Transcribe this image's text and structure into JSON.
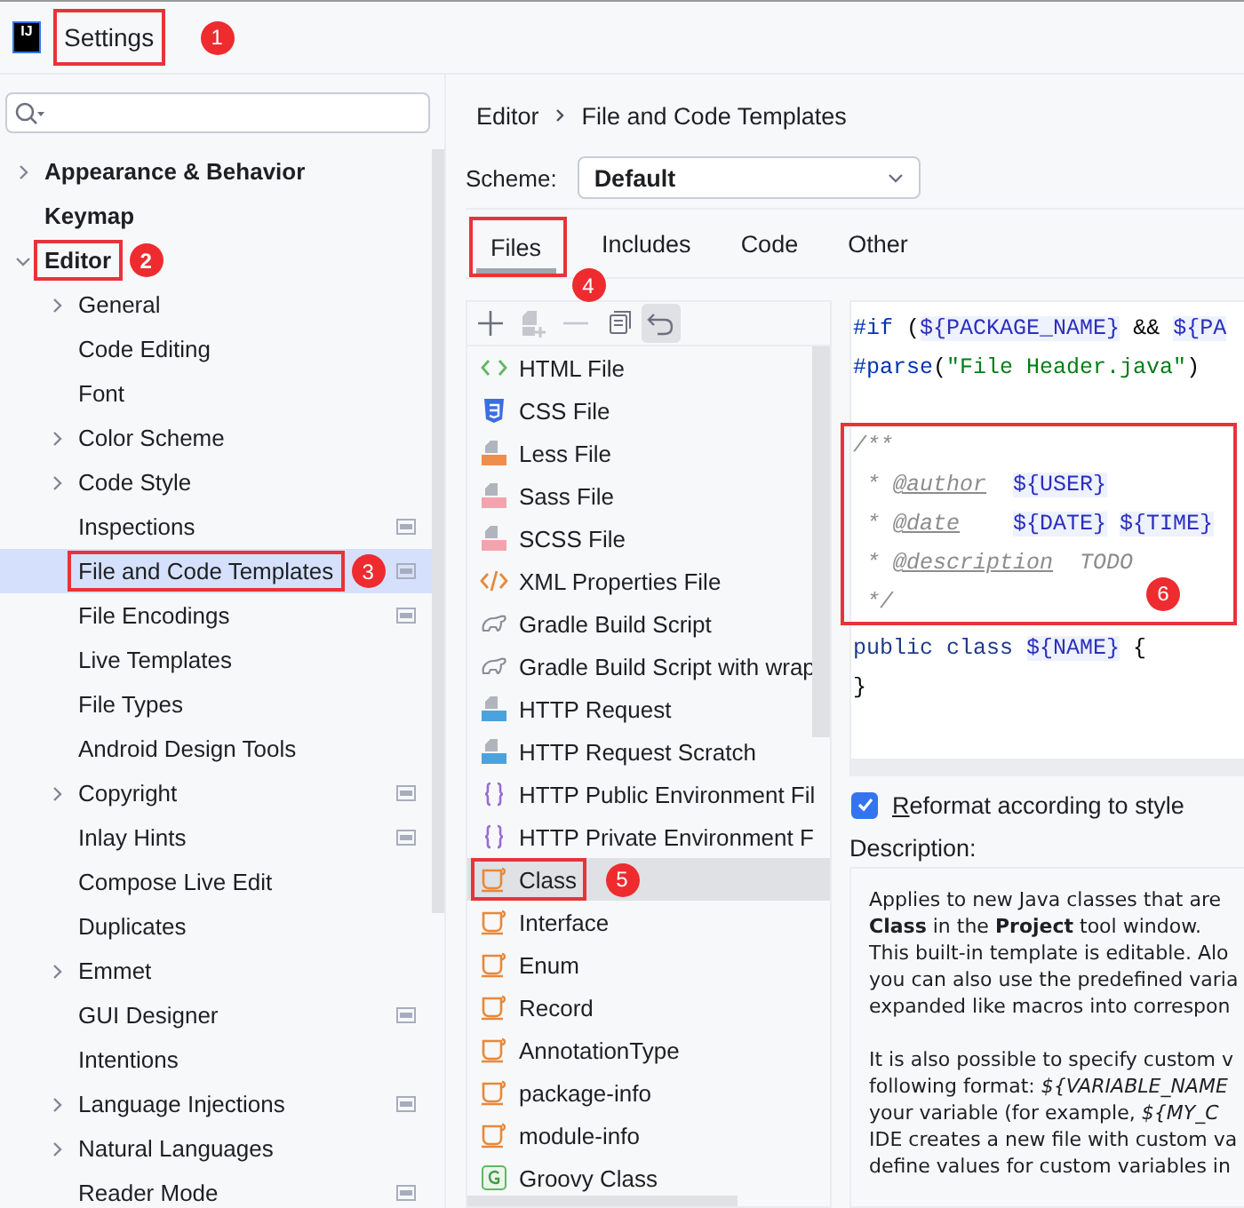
{
  "window": {
    "logo": "IJ",
    "title": "Settings",
    "callout": "1"
  },
  "sidebar": {
    "tree": [
      {
        "label": "Appearance & Behavior",
        "expandable": true,
        "expanded": false,
        "project_level": false,
        "selected": false
      },
      {
        "label": "Keymap",
        "expandable": false,
        "project_level": false,
        "selected": false
      },
      {
        "label": "Editor",
        "expandable": true,
        "expanded": true,
        "project_level": false,
        "selected": false,
        "callout": "2",
        "children": [
          {
            "label": "General",
            "expandable": true,
            "expanded": false,
            "project_level": false,
            "selected": false
          },
          {
            "label": "Code Editing",
            "expandable": false,
            "project_level": false,
            "selected": false
          },
          {
            "label": "Font",
            "expandable": false,
            "project_level": false,
            "selected": false
          },
          {
            "label": "Color Scheme",
            "expandable": true,
            "expanded": false,
            "project_level": false,
            "selected": false
          },
          {
            "label": "Code Style",
            "expandable": true,
            "expanded": false,
            "project_level": false,
            "selected": false
          },
          {
            "label": "Inspections",
            "expandable": false,
            "project_level": true,
            "selected": false
          },
          {
            "label": "File and Code Templates",
            "expandable": false,
            "project_level": true,
            "selected": true,
            "callout": "3"
          },
          {
            "label": "File Encodings",
            "expandable": false,
            "project_level": true,
            "selected": false
          },
          {
            "label": "Live Templates",
            "expandable": false,
            "project_level": false,
            "selected": false
          },
          {
            "label": "File Types",
            "expandable": false,
            "project_level": false,
            "selected": false
          },
          {
            "label": "Android Design Tools",
            "expandable": false,
            "project_level": false,
            "selected": false
          },
          {
            "label": "Copyright",
            "expandable": true,
            "expanded": false,
            "project_level": true,
            "selected": false
          },
          {
            "label": "Inlay Hints",
            "expandable": false,
            "project_level": true,
            "selected": false
          },
          {
            "label": "Compose Live Edit",
            "expandable": false,
            "project_level": false,
            "selected": false
          },
          {
            "label": "Duplicates",
            "expandable": false,
            "project_level": false,
            "selected": false
          },
          {
            "label": "Emmet",
            "expandable": true,
            "expanded": false,
            "project_level": false,
            "selected": false
          },
          {
            "label": "GUI Designer",
            "expandable": false,
            "project_level": true,
            "selected": false
          },
          {
            "label": "Intentions",
            "expandable": false,
            "project_level": false,
            "selected": false
          },
          {
            "label": "Language Injections",
            "expandable": true,
            "expanded": false,
            "project_level": true,
            "selected": false
          },
          {
            "label": "Natural Languages",
            "expandable": true,
            "expanded": false,
            "project_level": false,
            "selected": false
          },
          {
            "label": "Reader Mode",
            "expandable": false,
            "project_level": true,
            "selected": false
          }
        ]
      }
    ]
  },
  "breadcrumb": [
    "Editor",
    "File and Code Templates"
  ],
  "scheme": {
    "label": "Scheme:",
    "value": "Default"
  },
  "tabs": [
    {
      "label": "Files",
      "selected": true,
      "callout": "4"
    },
    {
      "label": "Includes",
      "selected": false
    },
    {
      "label": "Code",
      "selected": false
    },
    {
      "label": "Other",
      "selected": false
    }
  ],
  "templates": {
    "toolbar": [
      {
        "kind": "add",
        "disabled": false
      },
      {
        "kind": "add-child",
        "disabled": true
      },
      {
        "kind": "remove",
        "disabled": true
      },
      {
        "kind": "copy",
        "disabled": false
      },
      {
        "kind": "reset",
        "disabled": false
      }
    ],
    "items": [
      {
        "label": "HTML File",
        "kind": "html",
        "selected": false
      },
      {
        "label": "CSS File",
        "kind": "css",
        "selected": false
      },
      {
        "label": "Less File",
        "kind": "less",
        "selected": false
      },
      {
        "label": "Sass File",
        "kind": "sass",
        "selected": false
      },
      {
        "label": "SCSS File",
        "kind": "sass",
        "selected": false
      },
      {
        "label": "XML Properties File",
        "kind": "xml",
        "selected": false
      },
      {
        "label": "Gradle Build Script",
        "kind": "gradle",
        "selected": false
      },
      {
        "label": "Gradle Build Script with wrap",
        "kind": "gradle",
        "selected": false
      },
      {
        "label": "HTTP Request",
        "kind": "api",
        "selected": false
      },
      {
        "label": "HTTP Request Scratch",
        "kind": "api",
        "selected": false
      },
      {
        "label": "HTTP Public Environment Fil",
        "kind": "env",
        "selected": false
      },
      {
        "label": "HTTP Private Environment F",
        "kind": "env",
        "selected": false
      },
      {
        "label": "Class",
        "kind": "java",
        "selected": true,
        "callout": "5"
      },
      {
        "label": "Interface",
        "kind": "java",
        "selected": false
      },
      {
        "label": "Enum",
        "kind": "java",
        "selected": false
      },
      {
        "label": "Record",
        "kind": "java",
        "selected": false
      },
      {
        "label": "AnnotationType",
        "kind": "java",
        "selected": false
      },
      {
        "label": "package-info",
        "kind": "java",
        "selected": false
      },
      {
        "label": "module-info",
        "kind": "java",
        "selected": false
      },
      {
        "label": "Groovy Class",
        "kind": "groovy",
        "selected": false
      }
    ]
  },
  "editor": {
    "blocks": [
      {
        "lines": [
          [
            {
              "text": "#if",
              "kind": "directive"
            },
            {
              "text": " (",
              "kind": "plain"
            },
            {
              "text": "${PACKAGE_NAME}",
              "kind": "var"
            },
            {
              "text": " && ",
              "kind": "plain"
            },
            {
              "text": "${PA",
              "kind": "var"
            }
          ],
          [
            {
              "text": "#parse",
              "kind": "directive"
            },
            {
              "text": "(",
              "kind": "plain"
            },
            {
              "text": "\"File Header.java\"",
              "kind": "string"
            },
            {
              "text": ")",
              "kind": "plain"
            }
          ]
        ]
      },
      {
        "callout": "6",
        "lines": [
          [
            {
              "text": "/**",
              "kind": "comment"
            }
          ],
          [
            {
              "text": " * ",
              "kind": "comment"
            },
            {
              "text": "@author",
              "kind": "doctag"
            },
            {
              "text": "${USER}",
              "kind": "var"
            }
          ],
          [
            {
              "text": " * ",
              "kind": "comment"
            },
            {
              "text": "@date",
              "kind": "doctag"
            },
            {
              "text": "${DATE}",
              "kind": "var"
            },
            {
              "text": "${TIME}",
              "kind": "var"
            }
          ],
          [
            {
              "text": " * ",
              "kind": "comment"
            },
            {
              "text": "@description",
              "kind": "doctag"
            },
            {
              "text": "TODO",
              "kind": "comment"
            }
          ],
          [
            {
              "text": " */",
              "kind": "comment"
            }
          ]
        ]
      },
      {
        "lines": [
          [
            {
              "text": "public class ",
              "kind": "keyword"
            },
            {
              "text": "${NAME}",
              "kind": "var"
            },
            {
              "text": " {",
              "kind": "plain"
            }
          ],
          [
            {
              "text": "}",
              "kind": "plain"
            }
          ]
        ]
      }
    ]
  },
  "reformat": {
    "label": "Reformat according to style",
    "checked": true
  },
  "description": {
    "label": "Description:",
    "paragraphs": [
      [
        "Applies to new Java classes that are",
        "**Class** in the **Project** tool window.",
        "This built-in template is editable. Alo",
        "you can also use the predefined varia",
        "expanded like macros into correspon"
      ],
      [
        "It is also possible to specify custom v",
        "following format: *${VARIABLE_NAME*",
        "your variable (for example, *${MY_C*",
        "IDE creates a new file with custom va",
        "define values for custom variables in"
      ]
    ]
  }
}
